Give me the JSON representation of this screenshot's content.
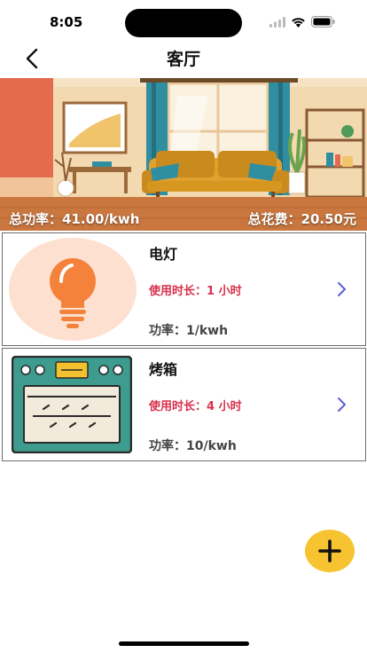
{
  "status_bar": {
    "time": "8:05"
  },
  "nav": {
    "title": "客厅",
    "back_icon": "chevron-left-icon"
  },
  "banner": {
    "total_power": "总功率：41.00/kwh",
    "total_cost": "总花费：20.50元"
  },
  "devices": [
    {
      "name": "电灯",
      "usage": "使用时长：1 小时",
      "power": "功率：1/kwh",
      "icon": "lightbulb-icon"
    },
    {
      "name": "烤箱",
      "usage": "使用时长：4 小时",
      "power": "功率：10/kwh",
      "icon": "oven-icon"
    }
  ],
  "fab": {
    "icon": "plus-icon"
  },
  "colors": {
    "usage_text": "#d8304b",
    "chevron": "#5b5fd6",
    "fab": "#f7c331",
    "bulb": "#f5823a"
  }
}
